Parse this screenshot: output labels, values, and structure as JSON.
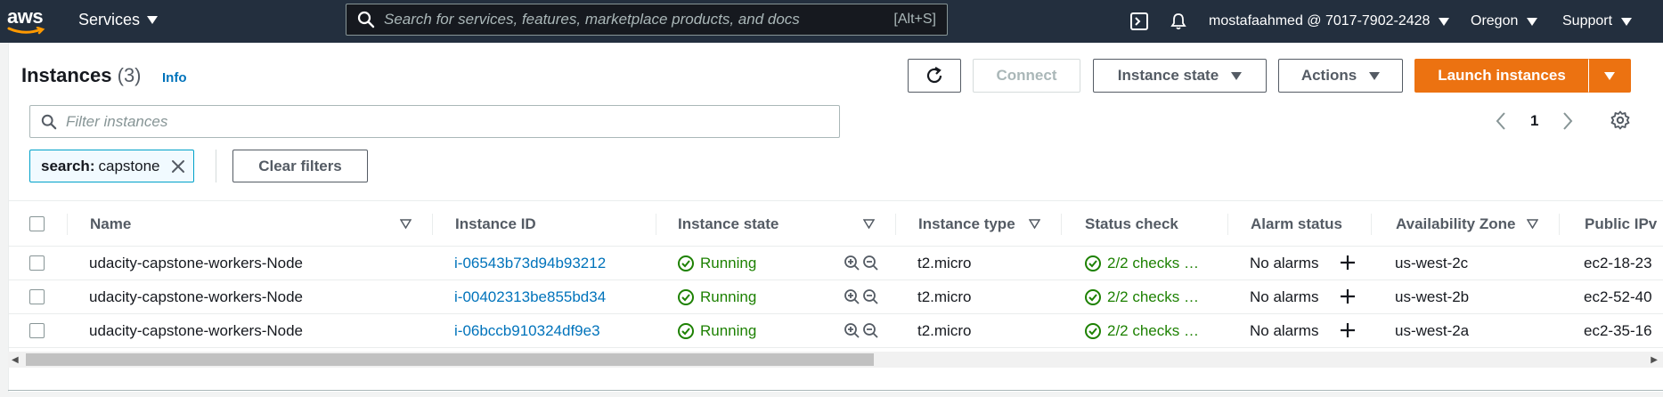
{
  "nav": {
    "logo_text": "aws",
    "services": "Services",
    "search_placeholder": "Search for services, features, marketplace products, and docs",
    "search_shortcut": "[Alt+S]",
    "account": "mostafaahmed @ 7017-7902-2428",
    "region": "Oregon",
    "support": "Support",
    "icons": [
      "cloudshell-icon",
      "bell-icon"
    ]
  },
  "header": {
    "title": "Instances",
    "count": "(3)",
    "info": "Info"
  },
  "actions": {
    "refresh_icon": "refresh-icon",
    "connect": "Connect",
    "instance_state": "Instance state",
    "actions": "Actions",
    "launch": "Launch instances"
  },
  "filter": {
    "placeholder": "Filter instances",
    "token_key": "search:",
    "token_value": "capstone",
    "clear": "Clear filters"
  },
  "pagination": {
    "page": "1"
  },
  "table": {
    "columns": [
      "Name",
      "Instance ID",
      "Instance state",
      "Instance type",
      "Status check",
      "Alarm status",
      "Availability Zone",
      "Public IPv"
    ],
    "rows": [
      {
        "name": "udacity-capstone-workers-Node",
        "id": "i-06543b73d94b93212",
        "state": "Running",
        "type": "t2.micro",
        "status": "2/2 checks …",
        "alarm": "No alarms",
        "az": "us-west-2c",
        "public": "ec2-18-23"
      },
      {
        "name": "udacity-capstone-workers-Node",
        "id": "i-00402313be855bd34",
        "state": "Running",
        "type": "t2.micro",
        "status": "2/2 checks …",
        "alarm": "No alarms",
        "az": "us-west-2b",
        "public": "ec2-52-40"
      },
      {
        "name": "udacity-capstone-workers-Node",
        "id": "i-06bccb910324df9e3",
        "state": "Running",
        "type": "t2.micro",
        "status": "2/2 checks …",
        "alarm": "No alarms",
        "az": "us-west-2a",
        "public": "ec2-35-16"
      }
    ]
  },
  "colors": {
    "nav_bg": "#232f3e",
    "accent": "#ec7211",
    "link": "#0073bb",
    "success": "#1d8102"
  }
}
